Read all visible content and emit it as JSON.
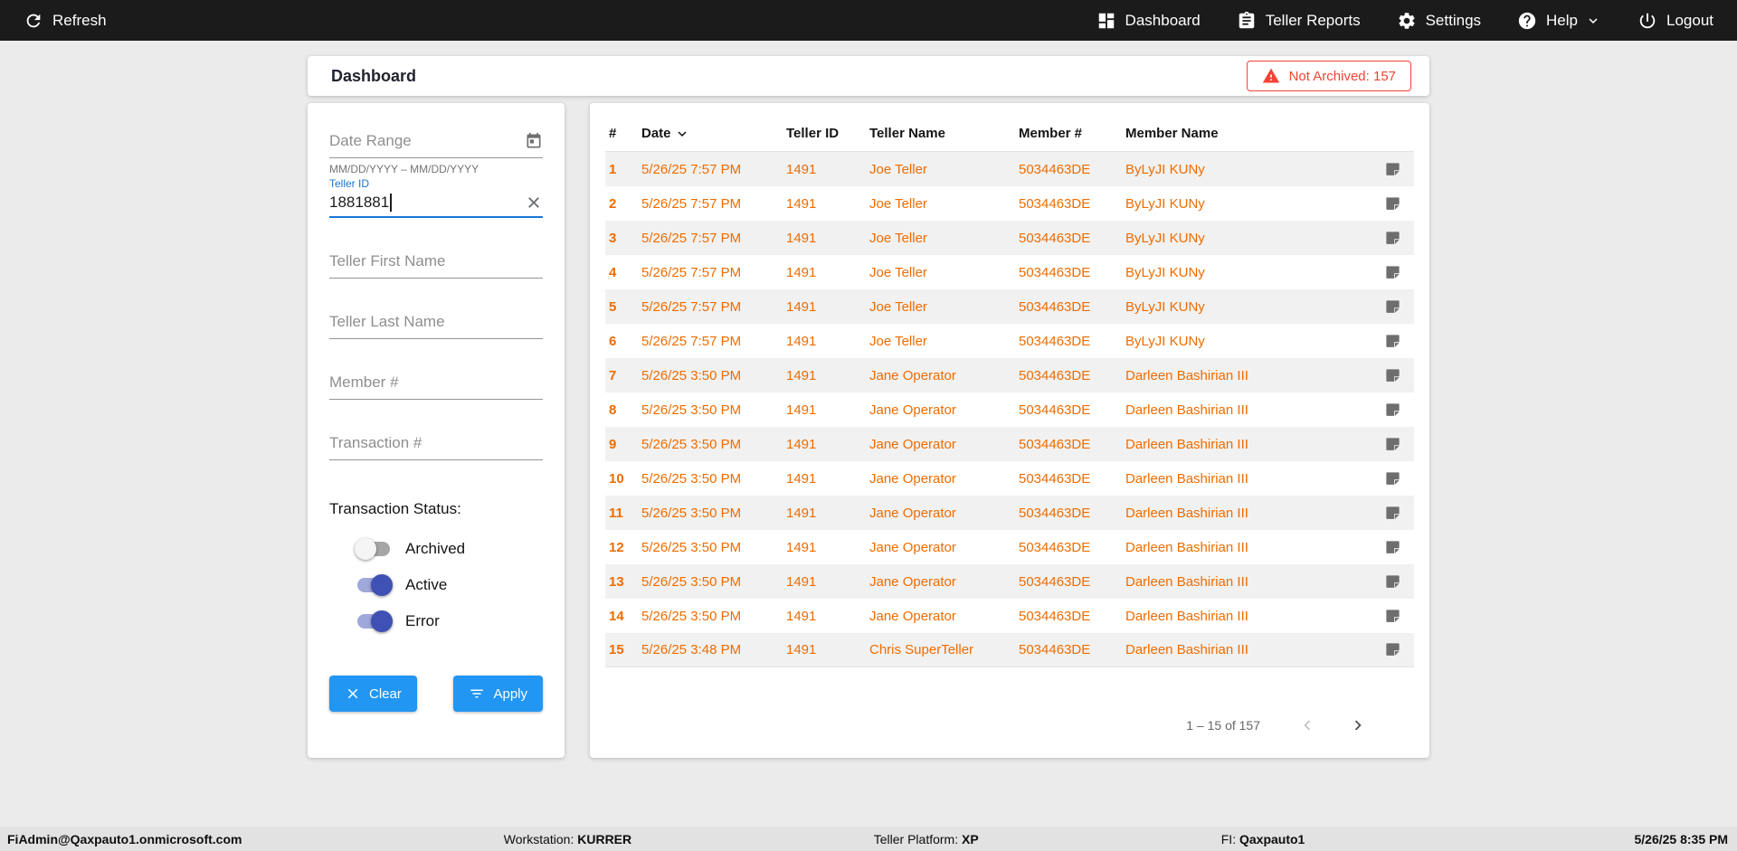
{
  "colors": {
    "accent": "#2196F3",
    "orange": "#EF6C00",
    "alert": "#F44336",
    "toggle-on": "#3F51B5",
    "toggle-track": "#9FA8DA",
    "label-blue": "#1976D2",
    "topbar-bg": "#1B1B1B"
  },
  "topbar": {
    "refresh_label": "Refresh",
    "items": [
      {
        "label": "Dashboard",
        "icon": "dashboard-icon"
      },
      {
        "label": "Teller Reports",
        "icon": "reports-icon"
      },
      {
        "label": "Settings",
        "icon": "settings-icon"
      },
      {
        "label": "Help",
        "icon": "help-icon"
      },
      {
        "label": "Logout",
        "icon": "logout-icon"
      }
    ]
  },
  "header": {
    "title": "Dashboard",
    "badge_label": "Not Archived: 157"
  },
  "filters": {
    "date_range": {
      "placeholder": "Date Range",
      "helper": "MM/DD/YYYY – MM/DD/YYYY"
    },
    "teller_id": {
      "label": "Teller ID",
      "value": "1881881"
    },
    "teller_first_name": {
      "placeholder": "Teller First Name"
    },
    "teller_last_name": {
      "placeholder": "Teller Last Name"
    },
    "member_number": {
      "placeholder": "Member #"
    },
    "transaction_number": {
      "placeholder": "Transaction #"
    },
    "status_label": "Transaction Status:",
    "toggles": [
      {
        "label": "Archived",
        "on": false
      },
      {
        "label": "Active",
        "on": true
      },
      {
        "label": "Error",
        "on": true
      }
    ],
    "clear_label": "Clear",
    "apply_label": "Apply"
  },
  "table": {
    "columns": [
      "#",
      "Date",
      "Teller ID",
      "Teller Name",
      "Member #",
      "Member Name"
    ],
    "rows": [
      {
        "num": "1",
        "date": "5/26/25 7:57 PM",
        "teller_id": "1491",
        "teller_name": "Joe Teller",
        "member": "5034463DE",
        "member_name": "ByLyJI KUNy"
      },
      {
        "num": "2",
        "date": "5/26/25 7:57 PM",
        "teller_id": "1491",
        "teller_name": "Joe Teller",
        "member": "5034463DE",
        "member_name": "ByLyJI KUNy"
      },
      {
        "num": "3",
        "date": "5/26/25 7:57 PM",
        "teller_id": "1491",
        "teller_name": "Joe Teller",
        "member": "5034463DE",
        "member_name": "ByLyJI KUNy"
      },
      {
        "num": "4",
        "date": "5/26/25 7:57 PM",
        "teller_id": "1491",
        "teller_name": "Joe Teller",
        "member": "5034463DE",
        "member_name": "ByLyJI KUNy"
      },
      {
        "num": "5",
        "date": "5/26/25 7:57 PM",
        "teller_id": "1491",
        "teller_name": "Joe Teller",
        "member": "5034463DE",
        "member_name": "ByLyJI KUNy"
      },
      {
        "num": "6",
        "date": "5/26/25 7:57 PM",
        "teller_id": "1491",
        "teller_name": "Joe Teller",
        "member": "5034463DE",
        "member_name": "ByLyJI KUNy"
      },
      {
        "num": "7",
        "date": "5/26/25 3:50 PM",
        "teller_id": "1491",
        "teller_name": "Jane Operator",
        "member": "5034463DE",
        "member_name": "Darleen Bashirian III"
      },
      {
        "num": "8",
        "date": "5/26/25 3:50 PM",
        "teller_id": "1491",
        "teller_name": "Jane Operator",
        "member": "5034463DE",
        "member_name": "Darleen Bashirian III"
      },
      {
        "num": "9",
        "date": "5/26/25 3:50 PM",
        "teller_id": "1491",
        "teller_name": "Jane Operator",
        "member": "5034463DE",
        "member_name": "Darleen Bashirian III"
      },
      {
        "num": "10",
        "date": "5/26/25 3:50 PM",
        "teller_id": "1491",
        "teller_name": "Jane Operator",
        "member": "5034463DE",
        "member_name": "Darleen Bashirian III"
      },
      {
        "num": "11",
        "date": "5/26/25 3:50 PM",
        "teller_id": "1491",
        "teller_name": "Jane Operator",
        "member": "5034463DE",
        "member_name": "Darleen Bashirian III"
      },
      {
        "num": "12",
        "date": "5/26/25 3:50 PM",
        "teller_id": "1491",
        "teller_name": "Jane Operator",
        "member": "5034463DE",
        "member_name": "Darleen Bashirian III"
      },
      {
        "num": "13",
        "date": "5/26/25 3:50 PM",
        "teller_id": "1491",
        "teller_name": "Jane Operator",
        "member": "5034463DE",
        "member_name": "Darleen Bashirian III"
      },
      {
        "num": "14",
        "date": "5/26/25 3:50 PM",
        "teller_id": "1491",
        "teller_name": "Jane Operator",
        "member": "5034463DE",
        "member_name": "Darleen Bashirian III"
      },
      {
        "num": "15",
        "date": "5/26/25 3:48 PM",
        "teller_id": "1491",
        "teller_name": "Chris SuperTeller",
        "member": "5034463DE",
        "member_name": "Darleen Bashirian III"
      }
    ],
    "pagination": {
      "range_label": "1 – 15 of 157"
    }
  },
  "footer": {
    "user": "FiAdmin@Qaxpauto1.onmicrosoft.com",
    "workstation_label": "Workstation:",
    "workstation": "KURRER",
    "platform_label": "Teller Platform:",
    "platform": "XP",
    "fi_label": "FI:",
    "fi": "Qaxpauto1",
    "datetime": "5/26/25 8:35 PM"
  }
}
